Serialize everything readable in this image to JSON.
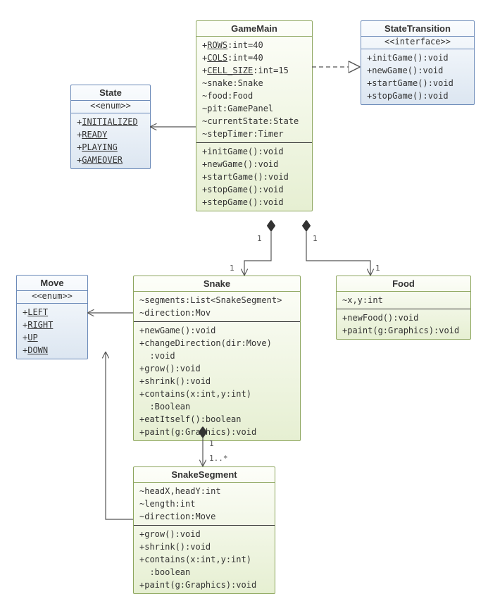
{
  "classes": {
    "gameMain": {
      "name": "GameMain",
      "attrs": [
        {
          "prefix": "+",
          "name": "ROWS",
          "rest": ":int=40",
          "static": true
        },
        {
          "prefix": "+",
          "name": "COLS",
          "rest": ":int=40",
          "static": true
        },
        {
          "prefix": "+",
          "name": "CELL_SIZE",
          "rest": ":int=15",
          "static": true
        },
        {
          "prefix": "~",
          "name": "snake",
          "rest": ":Snake"
        },
        {
          "prefix": "~",
          "name": "food",
          "rest": ":Food"
        },
        {
          "prefix": "~",
          "name": "pit",
          "rest": ":GamePanel"
        },
        {
          "prefix": "~",
          "name": "currentState",
          "rest": ":State"
        },
        {
          "prefix": "~",
          "name": "stepTimer",
          "rest": ":Timer"
        }
      ],
      "ops": [
        "+initGame():void",
        "+newGame():void",
        "+startGame():void",
        "+stopGame():void",
        "+stepGame():void"
      ]
    },
    "stateTransition": {
      "name": "StateTransition",
      "stereotype": "<<interface>>",
      "ops": [
        "+initGame():void",
        "+newGame():void",
        "+startGame():void",
        "+stopGame():void"
      ]
    },
    "state": {
      "name": "State",
      "stereotype": "<<enum>>",
      "literals": [
        "INITIALIZED",
        "READY",
        "PLAYING",
        "GAMEOVER"
      ]
    },
    "move": {
      "name": "Move",
      "stereotype": "<<enum>>",
      "literals": [
        "LEFT",
        "RIGHT",
        "UP",
        "DOWN"
      ]
    },
    "snake": {
      "name": "Snake",
      "attrs": [
        {
          "prefix": "~",
          "name": "segments",
          "rest": ":List<SnakeSegment>"
        },
        {
          "prefix": "~",
          "name": "direction",
          "rest": ":Mov"
        }
      ],
      "ops": [
        "+newGame():void",
        "+changeDirection(dir:Move)\n  :void",
        "+grow():void",
        "+shrink():void",
        "+contains(x:int,y:int)\n  :Boolean",
        "+eatItself():boolean",
        "+paint(g:Graphics):void"
      ]
    },
    "food": {
      "name": "Food",
      "attrs": [
        {
          "prefix": "~",
          "name": "x,y",
          "rest": ":int"
        }
      ],
      "ops": [
        "+newFood():void",
        "+paint(g:Graphics):void"
      ]
    },
    "snakeSegment": {
      "name": "SnakeSegment",
      "attrs": [
        {
          "prefix": "~",
          "name": "headX,headY",
          "rest": ":int"
        },
        {
          "prefix": "~",
          "name": "length",
          "rest": ":int"
        },
        {
          "prefix": "~",
          "name": "direction",
          "rest": ":Move"
        }
      ],
      "ops": [
        "+grow():void",
        "+shrink():void",
        "+contains(x:int,y:int)\n  :boolean",
        "+paint(g:Graphics):void"
      ]
    }
  },
  "multiplicities": {
    "gm_snake_top": "1",
    "gm_snake_bot": "1",
    "gm_food_top": "1",
    "gm_food_bot": "1",
    "snake_seg_top": "1",
    "snake_seg_bot": "1..*"
  }
}
